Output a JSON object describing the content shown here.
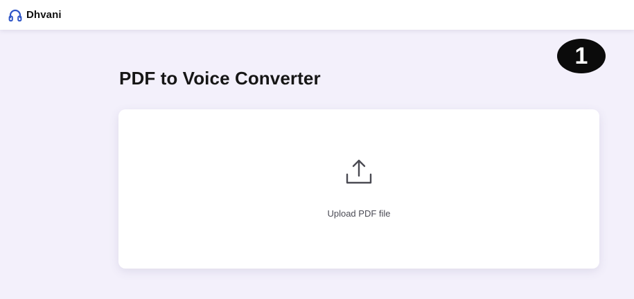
{
  "app": {
    "brand_name": "Dhvani",
    "brand_icon": "headphones-icon"
  },
  "step_badge": {
    "number": "1"
  },
  "main": {
    "title": "PDF to Voice Converter",
    "upload": {
      "icon": "upload-icon",
      "label": "Upload PDF file"
    }
  },
  "colors": {
    "brand_accent": "#2f55c7",
    "page_background": "#f3f0fb",
    "card_background": "#ffffff",
    "badge_background": "#0b0b0b"
  }
}
